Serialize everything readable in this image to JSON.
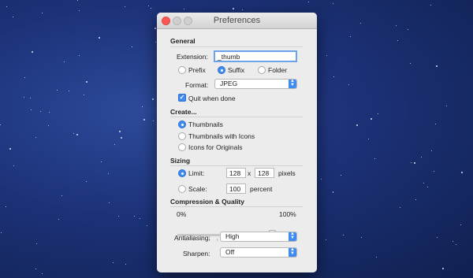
{
  "window": {
    "title": "Preferences"
  },
  "general": {
    "heading": "General",
    "extension_label": "Extension:",
    "extension_value": "_thumb",
    "placement_options": [
      {
        "label": "Prefix",
        "selected": false
      },
      {
        "label": "Suffix",
        "selected": true
      },
      {
        "label": "Folder",
        "selected": false
      }
    ],
    "format_label": "Format:",
    "format_value": "JPEG",
    "quit_label": "Quit when done",
    "quit_checked": true
  },
  "create": {
    "heading": "Create...",
    "options": [
      {
        "label": "Thumbnails",
        "selected": true
      },
      {
        "label": "Thumbnails with Icons",
        "selected": false
      },
      {
        "label": "Icons for Originals",
        "selected": false
      }
    ]
  },
  "sizing": {
    "heading": "Sizing",
    "limit_label": "Limit:",
    "limit_selected": true,
    "limit_width": "128",
    "limit_x": "x",
    "limit_height": "128",
    "limit_unit": "pixels",
    "scale_label": "Scale:",
    "scale_selected": false,
    "scale_value": "100",
    "scale_unit": "percent"
  },
  "compression": {
    "heading": "Compression & Quality",
    "min_label": "0%",
    "max_label": "100%",
    "quality_fraction": 0.8,
    "antialiasing_label": "Antialiasing:",
    "antialiasing_value": "High",
    "sharpen_label": "Sharpen:",
    "sharpen_value": "Off"
  },
  "colors": {
    "accent": "#3f8bf0",
    "close_button": "#fc5753"
  }
}
